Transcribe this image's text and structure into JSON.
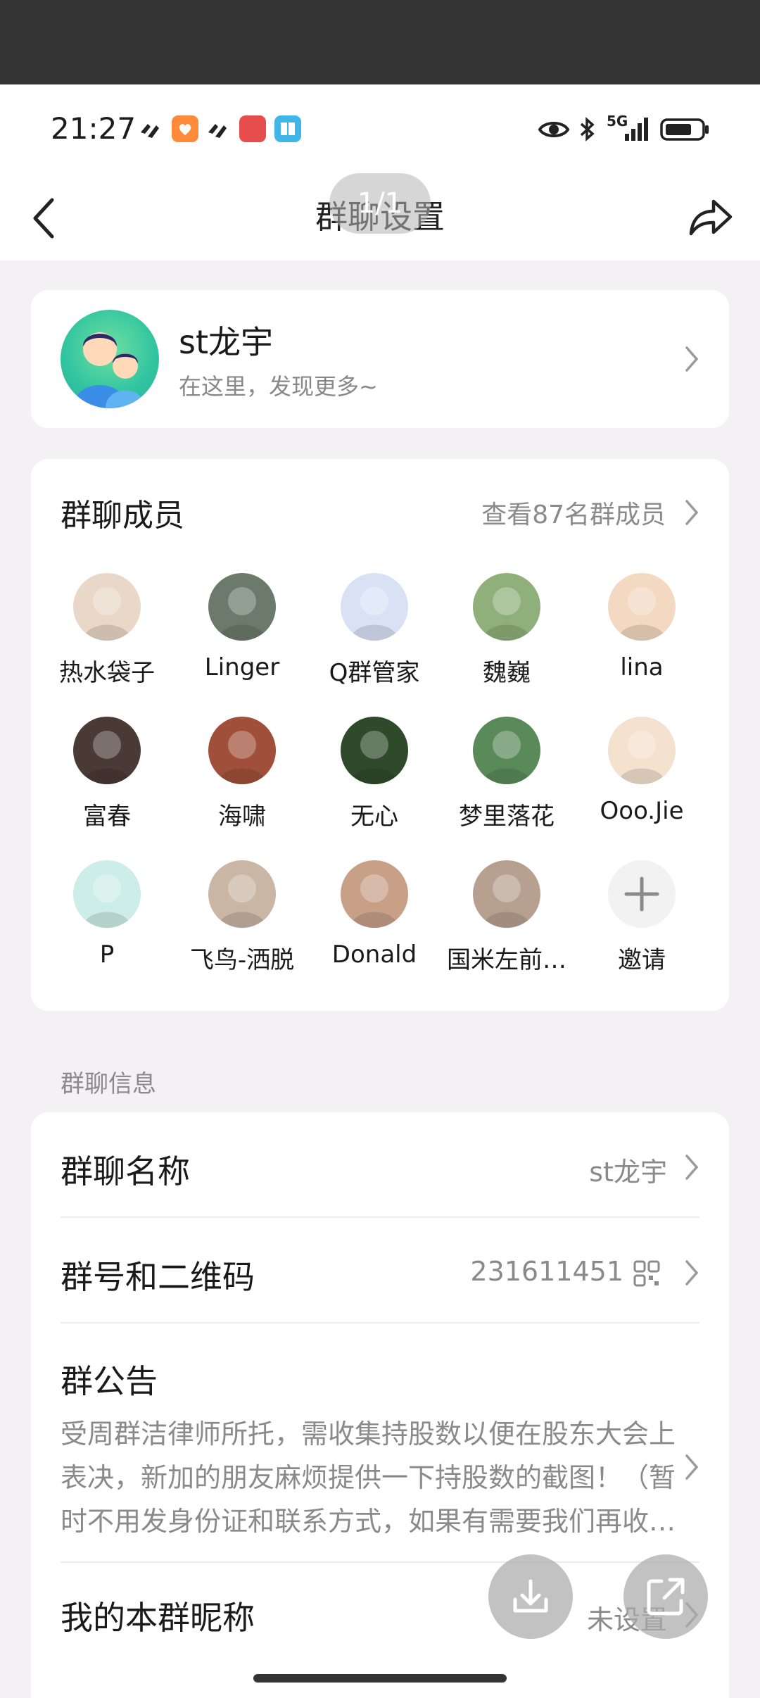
{
  "status_bar": {
    "time": "21:27",
    "network": "5G",
    "icons": [
      "signal-icon",
      "app-orange-icon",
      "signal-icon",
      "game-icon",
      "book-icon",
      "eye-icon",
      "bluetooth-icon",
      "cellular-icon",
      "battery-icon"
    ]
  },
  "nav": {
    "title": "群聊设置",
    "page_indicator": "1/1",
    "back_icon": "chevron-left-icon",
    "share_icon": "share-icon"
  },
  "profile": {
    "name": "st龙宇",
    "subtitle": "在这里，发现更多~"
  },
  "members": {
    "title": "群聊成员",
    "view_all": "查看87名群成员",
    "list": [
      {
        "name": "热水袋子",
        "color": "#e9d8c8"
      },
      {
        "name": "Linger",
        "color": "#6b7a6a"
      },
      {
        "name": "Q群管家",
        "color": "#d9e2f5"
      },
      {
        "name": "魏巍",
        "color": "#8fb07a"
      },
      {
        "name": "lina",
        "color": "#f3d9c2"
      },
      {
        "name": "富春",
        "color": "#4a3a36"
      },
      {
        "name": "海啸",
        "color": "#a0503a"
      },
      {
        "name": "无心",
        "color": "#2f4a2a"
      },
      {
        "name": "梦里落花",
        "color": "#5a8a5a"
      },
      {
        "name": "Ooo.Jie",
        "color": "#f4e2cf"
      },
      {
        "name": "P",
        "color": "#cdeee8"
      },
      {
        "name": "飞鸟-洒脱",
        "color": "#c9b6a4"
      },
      {
        "name": "Donald",
        "color": "#c8a088"
      },
      {
        "name": "国米左前…",
        "color": "#b8a090"
      },
      {
        "name": "邀请",
        "color": "#f2f2f2"
      }
    ]
  },
  "info": {
    "section_label": "群聊信息",
    "group_name_label": "群聊名称",
    "group_name_value": "st龙宇",
    "group_id_label": "群号和二维码",
    "group_id_value": "231611451",
    "notice_label": "群公告",
    "notice_text": "受周群洁律师所托，需收集持股数以便在股东大会上表决，新加的朋友麻烦提供一下持股数的截图！（暂时不用发身份证和联系方式，如果有需要我们再收…",
    "nickname_label": "我的本群昵称",
    "nickname_value": "未设置"
  },
  "colors": {
    "background": "#f4f1f5",
    "card": "#ffffff",
    "muted_text": "#8a8a8a"
  }
}
